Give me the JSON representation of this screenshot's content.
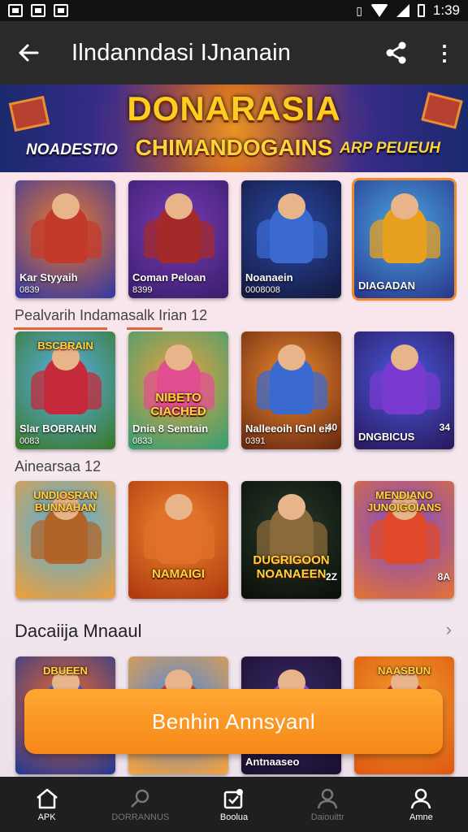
{
  "status_bar": {
    "time": "1:39"
  },
  "app_bar": {
    "title": "Ilndanndasi IJnanain"
  },
  "banner": {
    "title": "DONARASIA",
    "subtitle": "CHIMANDOGAINS",
    "left_tag": "NOADESTIO",
    "right_tag": "ARP PEUEUH"
  },
  "row1": [
    {
      "label": "Kar Styyaih",
      "sub": "0839",
      "c1": "#f07a2a",
      "c2": "#3b3a9e",
      "fig": "#c43a2a"
    },
    {
      "label": "Coman Peloan",
      "sub": "8399",
      "c1": "#7a3bb5",
      "c2": "#3a1f6e",
      "fig": "#a42a2a"
    },
    {
      "label": "Noanaein",
      "sub": "0008008",
      "c1": "#2a4aa8",
      "c2": "#141a40",
      "fig": "#3a6ad0"
    },
    {
      "label": "DIAGADAN",
      "sub": "",
      "c1": "#4aa8e0",
      "c2": "#2a3a90",
      "fig": "#e8a020"
    }
  ],
  "label1": "Pealvarih Indamasalk Irian 12",
  "row2": [
    {
      "label": "Slar BOBRAHN",
      "sub": "0083",
      "logo": "BSCBRAIN",
      "c1": "#5ab0e8",
      "c2": "#3a7a30",
      "fig": "#c42a3a"
    },
    {
      "label": "Dnia 8 Semtain",
      "sub": "0833",
      "center": "NIBETO CIACHED",
      "c1": "#f0a040",
      "c2": "#3aa070",
      "fig": "#e05090"
    },
    {
      "label": "Nalleeoih IGnl eir",
      "sub": "0391",
      "badge": "40",
      "c1": "#f08a30",
      "c2": "#6a2a10",
      "fig": "#3a6ad0"
    },
    {
      "label": "DNGBICUS",
      "sub": "",
      "badge": "34",
      "c1": "#4a5ae0",
      "c2": "#2a1a60",
      "fig": "#7a3ad0"
    }
  ],
  "label2": "Ainearsaa 12",
  "row3": [
    {
      "logo": "UNDIOSRAN BUNNAHAN",
      "c1": "#4ab0e8",
      "c2": "#e8a040",
      "fig": "#b0642a"
    },
    {
      "center": "NAMAIGI",
      "c1": "#f08a30",
      "c2": "#b03a10",
      "fig": "#e0702a"
    },
    {
      "center": "DUGRIGOON NOANAEEN",
      "badge": "2Z",
      "c1": "#2a3a2a",
      "c2": "#0a100a",
      "fig": "#8a6a3a"
    },
    {
      "logo": "MENDIANO JUNOIGOIANS",
      "badge": "8A",
      "c1": "#7a4ad0",
      "c2": "#e0703a",
      "fig": "#e04a2a"
    }
  ],
  "section_heading": "Dacaiija Mnaaul",
  "row4": [
    {
      "logo": "DBUEEN",
      "c1": "#f06a2a",
      "c2": "#2a3a90",
      "fig": "#3a5ad0"
    },
    {
      "c1": "#4a8ae0",
      "c2": "#f0a040",
      "fig": "#c43a2a"
    },
    {
      "label": "Antnaaseo",
      "c1": "#3a2a6a",
      "c2": "#1a1030",
      "fig": "#8a4ad0"
    },
    {
      "logo": "NAASBUN",
      "c1": "#f0a030",
      "c2": "#e05a10",
      "fig": "#c42a2a"
    }
  ],
  "cta_label": "Benhin Annsyanl",
  "nav": [
    {
      "label": "APK"
    },
    {
      "label": "DORRANNUS"
    },
    {
      "label": "Boolua"
    },
    {
      "label": "Daiouittr"
    },
    {
      "label": "Amne"
    }
  ]
}
